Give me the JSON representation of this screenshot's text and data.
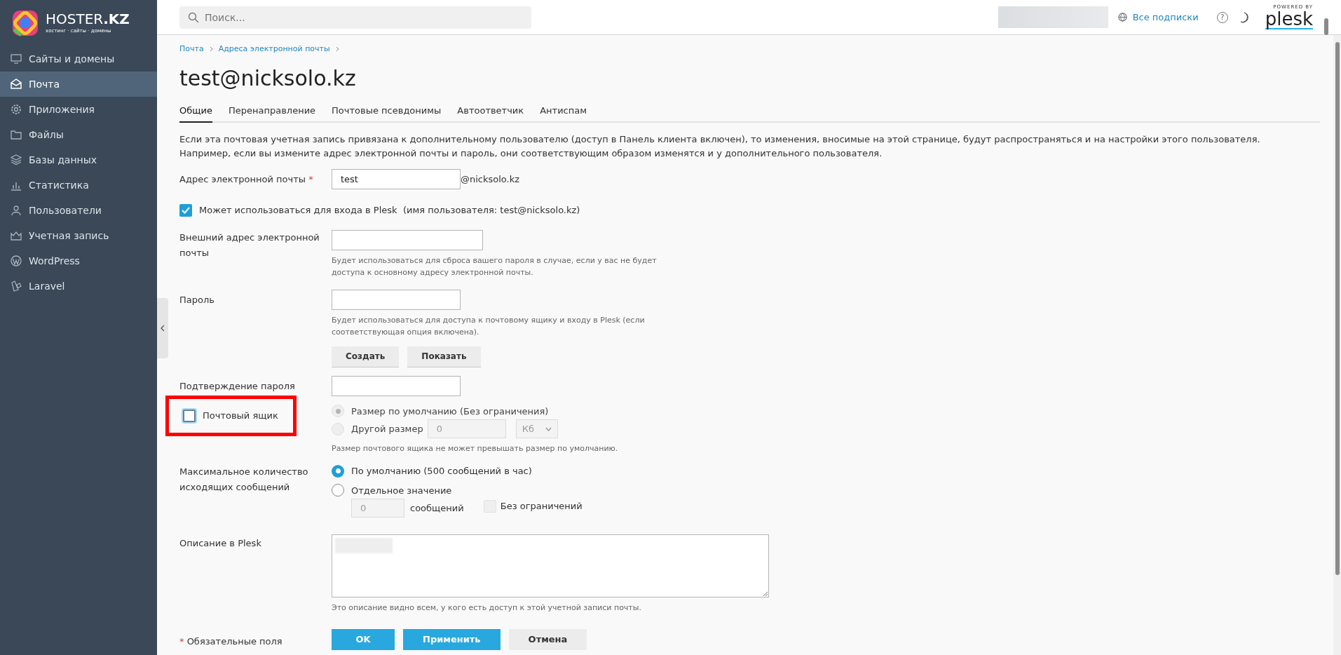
{
  "brand": {
    "name": "HOSTER",
    "name_bold": ".KZ",
    "tagline": "хостинг · сайты · домены"
  },
  "sidebar": {
    "items": [
      {
        "label": "Сайты и домены",
        "selected": false
      },
      {
        "label": "Почта",
        "selected": true
      },
      {
        "label": "Приложения",
        "selected": false
      },
      {
        "label": "Файлы",
        "selected": false
      },
      {
        "label": "Базы данных",
        "selected": false
      },
      {
        "label": "Статистика",
        "selected": false
      },
      {
        "label": "Пользователи",
        "selected": false
      },
      {
        "label": "Учетная запись",
        "selected": false
      },
      {
        "label": "WordPress",
        "selected": false
      },
      {
        "label": "Laravel",
        "selected": false
      }
    ]
  },
  "topbar": {
    "search_placeholder": "Поиск...",
    "subscriptions": "Все подписки",
    "help": "?",
    "powered_by": "POWERED BY",
    "plesk": "plesk"
  },
  "breadcrumbs": [
    "Почта",
    "Адреса электронной почты"
  ],
  "title": "test@nicksolo.kz",
  "tabs": [
    {
      "label": "Общие",
      "selected": true
    },
    {
      "label": "Перенаправление",
      "selected": false
    },
    {
      "label": "Почтовые псевдонимы",
      "selected": false
    },
    {
      "label": "Автоответчик",
      "selected": false
    },
    {
      "label": "Антиспам",
      "selected": false
    }
  ],
  "intro": "Если эта почтовая учетная запись привязана к дополнительному пользователю (доступ в Панель клиента включен), то изменения, вносимые на этой странице, будут распространяться и на настройки этого пользователя. Например, если вы измените адрес электронной почты и пароль, они соответствующим образом изменятся и у дополнительного пользователя.",
  "email": {
    "label": "Адрес электронной почты",
    "required_mark": "*",
    "value": "test",
    "domain": "@nicksolo.kz"
  },
  "plesk_login": {
    "label": "Может использоваться для входа в Plesk  (имя пользователя: test@nicksolo.kz)",
    "checked": true
  },
  "external_email": {
    "label": "Внешний адрес электронной почты",
    "hint": "Будет использоваться для сброса вашего пароля в случае, если у вас не будет доступа к основному адресу электронной почты."
  },
  "password": {
    "label": "Пароль",
    "hint": "Будет использоваться для доступа к почтовому ящику и входу в Plesk (если соответствующая опция включена).",
    "buttons": [
      "Создать",
      "Показать"
    ]
  },
  "password_confirm": {
    "label": "Подтверждение пароля"
  },
  "mailbox": {
    "label": "Почтовый ящик",
    "checked": false,
    "highlighted": true,
    "options": [
      {
        "label": "Размер по умолчанию (Без ограничения)",
        "selected": true,
        "disabled": true
      },
      {
        "label": "Другой размер",
        "selected": false,
        "disabled": true
      }
    ],
    "size_value": "0",
    "size_unit": "Кб",
    "hint": "Размер почтового ящика не может превышать размер по умолчанию."
  },
  "outgoing": {
    "label": "Максимальное количество исходящих сообщений",
    "options": [
      {
        "label": "По умолчанию (500 сообщений в час)",
        "selected": true,
        "disabled": false
      },
      {
        "label": "Отдельное значение",
        "selected": false,
        "disabled": false
      }
    ],
    "value": "0",
    "unit": "сообщений",
    "unlimited": {
      "label": "Без ограничений",
      "checked": false,
      "disabled": true
    }
  },
  "description": {
    "label": "Описание в Plesk",
    "hint": "Это описание видно всем, у кого есть доступ к этой учетной записи почты."
  },
  "required_note": {
    "mark": "*",
    "text": "Обязательные поля"
  },
  "actions": [
    {
      "label": "OK",
      "kind": "primary"
    },
    {
      "label": "Применить",
      "kind": "primary"
    },
    {
      "label": "Отмена",
      "kind": "secondary"
    }
  ]
}
